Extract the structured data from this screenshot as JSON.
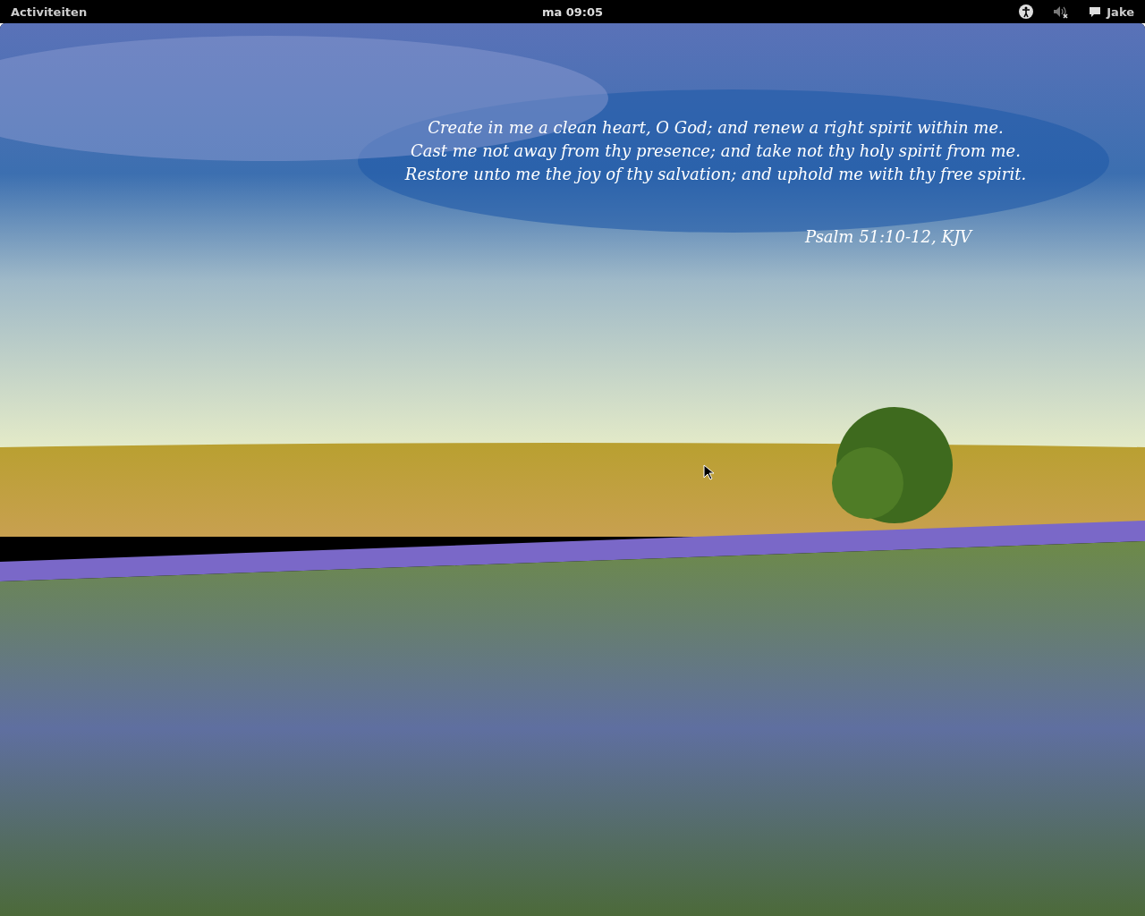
{
  "top_bar": {
    "activities": "Activiteiten",
    "clock": "ma 09:05",
    "volume_muted": true,
    "user": "Jake"
  },
  "desktop": {
    "verse_lines": [
      "Create in me a clean heart, O God; and renew a right spirit within me.",
      "Cast me not away from thy presence; and take not thy holy spirit from me.",
      "Restore unto me the joy of thy salvation; and uphold me with thy free spirit."
    ],
    "attribution": "Psalm 51:10-12, KJV"
  }
}
